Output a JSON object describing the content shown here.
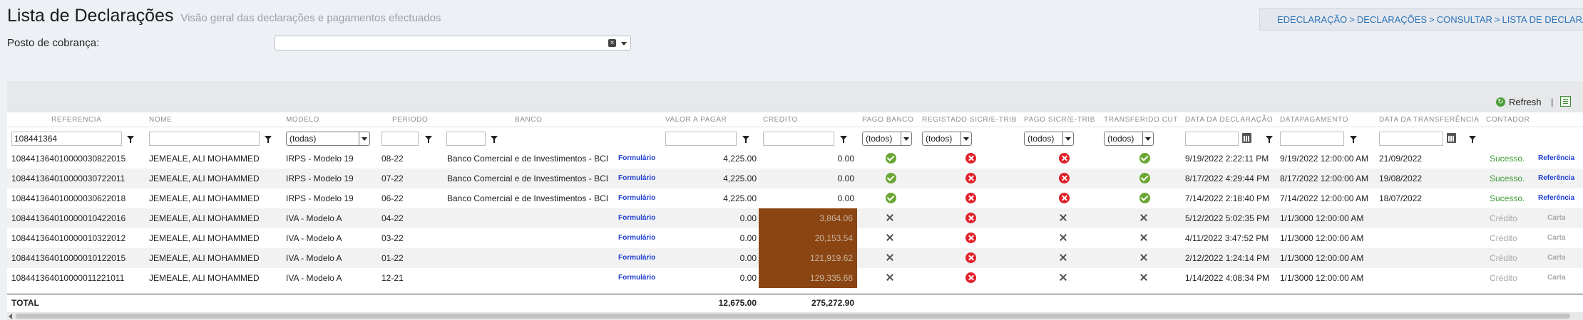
{
  "page": {
    "title": "Lista de Declarações",
    "subtitle": "Visão geral das declarações e pagamentos efectuados"
  },
  "breadcrumb": {
    "items": [
      "EDECLARAÇÃO",
      "DECLARAÇÕES",
      "CONSULTAR",
      "LISTA DE DECLARAÇÕES"
    ],
    "separator": ">"
  },
  "posto": {
    "label": "Posto de cobrança:",
    "value": ""
  },
  "toolbar": {
    "refresh_label": "Refresh",
    "separator": "|"
  },
  "columns": {
    "referencia": "REFERENCIA",
    "nome": "NOME",
    "modelo": "MODELO",
    "periodo": "PERIODO",
    "banco": "BANCO",
    "valor": "VALOR A PAGAR",
    "credito": "CREDITO",
    "pago_banco": "PAGO BANCO",
    "registado": "REGISTADO SICR/E-TRIB",
    "pago_sicr": "PAGO SICR/E-TRIB",
    "transferido": "TRANSFERIDO CUT",
    "data_decl": "DATA DA DECLARAÇÃO",
    "data_pag": "DATAPAGAMENTO",
    "data_transf": "DATA DA TRANSFERÊNCIA",
    "contador": "CONTADOR"
  },
  "filters": {
    "referencia": "108441364",
    "modelo": "(todas)",
    "pago_banco": "(todos)",
    "registado": "(todos)",
    "pago_sicr": "(todos)",
    "transferido": "(todos)"
  },
  "rows": [
    {
      "referencia": "108441364010000030822015",
      "nome": "JEMEALE, ALI MOHAMMED",
      "modelo": "IRPS - Modelo 19",
      "periodo": "08-22",
      "banco": "Banco Comercial e de Investimentos - BCI",
      "form": "Formulário",
      "valor": "4,225.00",
      "credito": "0.00",
      "credit_highlight": false,
      "pago_banco": "ok",
      "registado": "error",
      "pago_sicr": "error",
      "transferido": "ok",
      "data_decl": "9/19/2022 2:22:11 PM",
      "data_pag": "9/19/2022 12:00:00 AM",
      "data_transf": "21/09/2022",
      "status": "Sucesso.",
      "status_type": "ok",
      "ref_label": "Referência",
      "ref_type": "link"
    },
    {
      "referencia": "108441364010000030722011",
      "nome": "JEMEALE, ALI MOHAMMED",
      "modelo": "IRPS - Modelo 19",
      "periodo": "07-22",
      "banco": "Banco Comercial e de Investimentos - BCI",
      "form": "Formulário",
      "valor": "4,225.00",
      "credito": "0.00",
      "credit_highlight": false,
      "pago_banco": "ok",
      "registado": "error",
      "pago_sicr": "error",
      "transferido": "ok",
      "data_decl": "8/17/2022 4:29:44 PM",
      "data_pag": "8/17/2022 12:00:00 AM",
      "data_transf": "19/08/2022",
      "status": "Sucesso.",
      "status_type": "ok",
      "ref_label": "Referência",
      "ref_type": "link"
    },
    {
      "referencia": "108441364010000030622018",
      "nome": "JEMEALE, ALI MOHAMMED",
      "modelo": "IRPS - Modelo 19",
      "periodo": "06-22",
      "banco": "Banco Comercial e de Investimentos - BCI",
      "form": "Formulário",
      "valor": "4,225.00",
      "credito": "0.00",
      "credit_highlight": false,
      "pago_banco": "ok",
      "registado": "error",
      "pago_sicr": "error",
      "transferido": "ok",
      "data_decl": "7/14/2022 2:18:40 PM",
      "data_pag": "7/14/2022 12:00:00 AM",
      "data_transf": "18/07/2022",
      "status": "Sucesso.",
      "status_type": "ok",
      "ref_label": "Referência",
      "ref_type": "link"
    },
    {
      "referencia": "108441364010000010422016",
      "nome": "JEMEALE, ALI MOHAMMED",
      "modelo": "IVA - Modelo A",
      "periodo": "04-22",
      "banco": "",
      "form": "Formulário",
      "valor": "0.00",
      "credito": "3,864.06",
      "credit_highlight": true,
      "pago_banco": "x",
      "registado": "error",
      "pago_sicr": "x",
      "transferido": "x",
      "data_decl": "5/12/2022 5:02:35 PM",
      "data_pag": "1/1/3000 12:00:00 AM",
      "data_transf": "",
      "status": "Crédito",
      "status_type": "grey",
      "ref_label": "Carta",
      "ref_type": "grey"
    },
    {
      "referencia": "108441364010000010322012",
      "nome": "JEMEALE, ALI MOHAMMED",
      "modelo": "IVA - Modelo A",
      "periodo": "03-22",
      "banco": "",
      "form": "Formulário",
      "valor": "0.00",
      "credito": "20,153.54",
      "credit_highlight": true,
      "pago_banco": "x",
      "registado": "error",
      "pago_sicr": "x",
      "transferido": "x",
      "data_decl": "4/11/2022 3:47:52 PM",
      "data_pag": "1/1/3000 12:00:00 AM",
      "data_transf": "",
      "status": "Crédito",
      "status_type": "grey",
      "ref_label": "Carta",
      "ref_type": "grey"
    },
    {
      "referencia": "108441364010000010122015",
      "nome": "JEMEALE, ALI MOHAMMED",
      "modelo": "IVA - Modelo A",
      "periodo": "01-22",
      "banco": "",
      "form": "Formulário",
      "valor": "0.00",
      "credito": "121,919.62",
      "credit_highlight": true,
      "pago_banco": "x",
      "registado": "error",
      "pago_sicr": "x",
      "transferido": "x",
      "data_decl": "2/12/2022 1:24:14 PM",
      "data_pag": "1/1/3000 12:00:00 AM",
      "data_transf": "",
      "status": "Crédito",
      "status_type": "grey",
      "ref_label": "Carta",
      "ref_type": "grey"
    },
    {
      "referencia": "108441364010000011221011",
      "nome": "JEMEALE, ALI MOHAMMED",
      "modelo": "IVA - Modelo A",
      "periodo": "12-21",
      "banco": "",
      "form": "Formulário",
      "valor": "0.00",
      "credito": "129,335.68",
      "credit_highlight": true,
      "pago_banco": "x",
      "registado": "error",
      "pago_sicr": "x",
      "transferido": "x",
      "data_decl": "1/14/2022 4:08:34 PM",
      "data_pag": "1/1/3000 12:00:00 AM",
      "data_transf": "",
      "status": "Crédito",
      "status_type": "grey",
      "ref_label": "Carta",
      "ref_type": "grey"
    }
  ],
  "totals": {
    "label": "TOTAL",
    "valor": "12,675.00",
    "credito": "275,272.90"
  },
  "colors": {
    "credit_highlight": "#8b4513",
    "success": "#3d9a34",
    "link": "#1f3fcf",
    "breadcrumb": "#2d72b6"
  }
}
